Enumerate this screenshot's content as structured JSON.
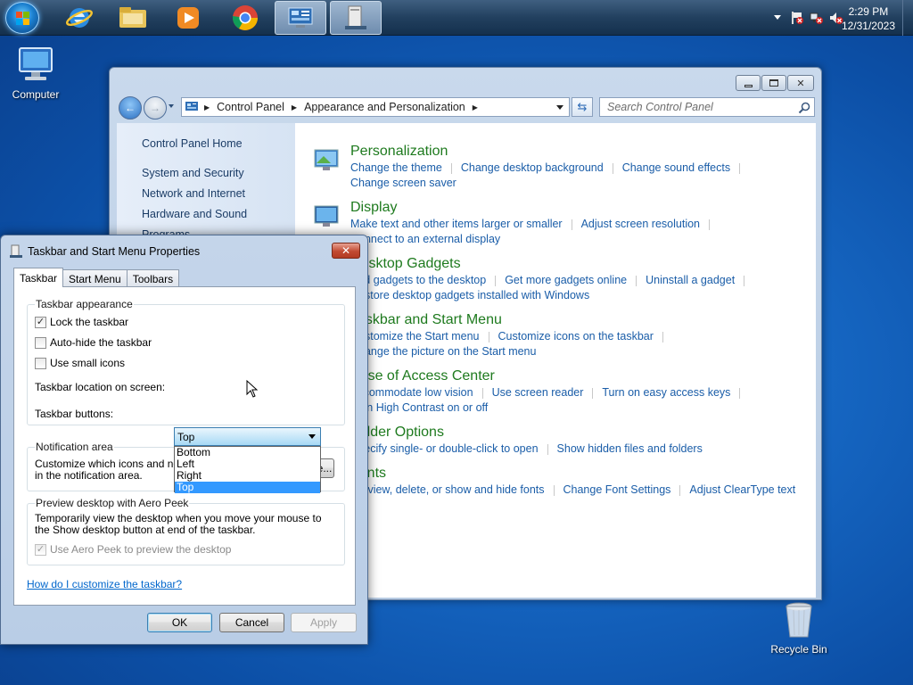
{
  "taskbar": {
    "time": "2:29 PM",
    "date": "12/31/2023"
  },
  "desktop": {
    "computer_label": "Computer",
    "recycle_bin_label": "Recycle Bin"
  },
  "control_panel": {
    "breadcrumb": [
      "Control Panel",
      "Appearance and Personalization"
    ],
    "search_placeholder": "Search Control Panel",
    "sidebar": [
      "Control Panel Home",
      "System and Security",
      "Network and Internet",
      "Hardware and Sound",
      "Programs"
    ],
    "categories": [
      {
        "title": "Personalization",
        "links": [
          "Change the theme",
          "Change desktop background",
          "Change sound effects",
          "Change screen saver"
        ]
      },
      {
        "title": "Display",
        "links": [
          "Make text and other items larger or smaller",
          "Adjust screen resolution",
          "Connect to an external display"
        ]
      },
      {
        "title": "Desktop Gadgets",
        "links": [
          "Add gadgets to the desktop",
          "Get more gadgets online",
          "Uninstall a gadget",
          "Restore desktop gadgets installed with Windows"
        ]
      },
      {
        "title": "Taskbar and Start Menu",
        "links": [
          "Customize the Start menu",
          "Customize icons on the taskbar",
          "Change the picture on the Start menu"
        ]
      },
      {
        "title": "Ease of Access Center",
        "links": [
          "Accommodate low vision",
          "Use screen reader",
          "Turn on easy access keys",
          "Turn High Contrast on or off"
        ]
      },
      {
        "title": "Folder Options",
        "links": [
          "Specify single- or double-click to open",
          "Show hidden files and folders"
        ]
      },
      {
        "title": "Fonts",
        "links": [
          "Preview, delete, or show and hide fonts",
          "Change Font Settings",
          "Adjust ClearType text"
        ]
      }
    ]
  },
  "dialog": {
    "title": "Taskbar and Start Menu Properties",
    "close_glyph": "✕",
    "tabs": [
      "Taskbar",
      "Start Menu",
      "Toolbars"
    ],
    "appearance": {
      "label": "Taskbar appearance",
      "lock": "Lock the taskbar",
      "autohide": "Auto-hide the taskbar",
      "small_icons": "Use small icons",
      "location_label": "Taskbar location on screen:",
      "location_value": "Top",
      "location_options": [
        "Bottom",
        "Left",
        "Right",
        "Top"
      ],
      "buttons_label": "Taskbar buttons:"
    },
    "notification": {
      "label": "Notification area",
      "text": "Customize which icons and notifications appear in the notification area.",
      "button": "Customize..."
    },
    "aero_peek": {
      "label": "Preview desktop with Aero Peek",
      "text": "Temporarily view the desktop when you move your mouse to the Show desktop button at end of the taskbar.",
      "checkbox": "Use Aero Peek to preview the desktop"
    },
    "help_link": "How do I customize the taskbar?",
    "ok": "OK",
    "cancel": "Cancel",
    "apply": "Apply"
  }
}
